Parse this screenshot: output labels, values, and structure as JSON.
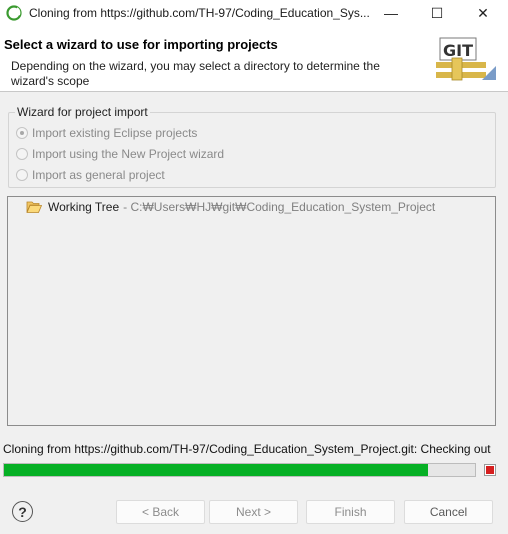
{
  "window": {
    "title": "Cloning from https://github.com/TH-97/Coding_Education_Sys...",
    "minimize_glyph": "—",
    "maximize_glyph": "☐",
    "close_glyph": "✕"
  },
  "header": {
    "title": "Select a wizard to use for importing projects",
    "description": "Depending on the wizard, you may select a directory to determine the wizard's scope",
    "banner_icon": "git-logo-icon",
    "banner_text": "GIT"
  },
  "wizard_group": {
    "label": "Wizard for project import",
    "options": [
      {
        "label": "Import existing Eclipse projects",
        "selected": true,
        "enabled": false
      },
      {
        "label": "Import using the New Project wizard",
        "selected": false,
        "enabled": false
      },
      {
        "label": "Import as general project",
        "selected": false,
        "enabled": false
      }
    ]
  },
  "tree": {
    "items": [
      {
        "icon": "folder-open-icon",
        "name": "Working Tree",
        "path": "- C:₩Users₩HJ₩git₩Coding_Education_System_Project"
      }
    ]
  },
  "status": {
    "text": "Cloning from https://github.com/TH-97/Coding_Education_System_Project.git: Checking out",
    "progress": 0.9,
    "progress_color": "#06b025"
  },
  "buttons": {
    "help": "?",
    "back": "< Back",
    "next": "Next >",
    "finish": "Finish",
    "cancel": "Cancel"
  }
}
